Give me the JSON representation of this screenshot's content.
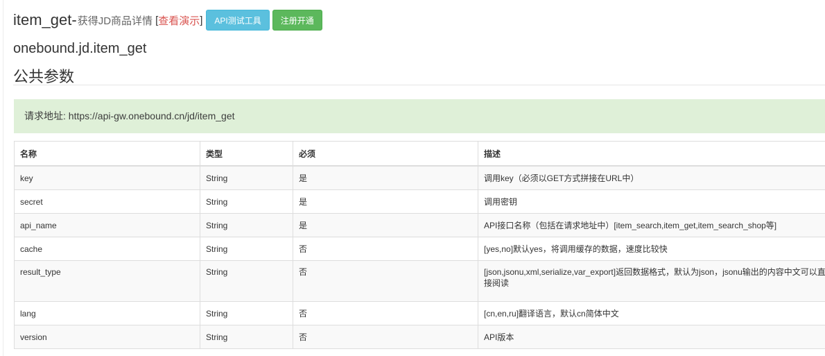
{
  "header": {
    "api_name": "item_get",
    "dash": "-",
    "subtitle": "获得JD商品详情",
    "bracket_open": "[",
    "demo_link": "查看演示",
    "bracket_close": "]",
    "api_test_button": "API测试工具",
    "register_button": "注册开通"
  },
  "method_name": "onebound.jd.item_get",
  "section_title": "公共参数",
  "request_url": "请求地址: https://api-gw.onebound.cn/jd/item_get",
  "table": {
    "headers": [
      "名称",
      "类型",
      "必须",
      "描述"
    ],
    "rows": [
      [
        "key",
        "String",
        "是",
        "调用key（必须以GET方式拼接在URL中）"
      ],
      [
        "secret",
        "String",
        "是",
        "调用密钥"
      ],
      [
        "api_name",
        "String",
        "是",
        "API接口名称（包括在请求地址中）[item_search,item_get,item_search_shop等]"
      ],
      [
        "cache",
        "String",
        "否",
        "[yes,no]默认yes，将调用缓存的数据，速度比较快"
      ],
      [
        "result_type",
        "String",
        "否",
        "[json,jsonu,xml,serialize,var_export]返回数据格式，默认为json，jsonu输出的内容中文可以直接阅读"
      ],
      [
        "lang",
        "String",
        "否",
        "[cn,en,ru]翻译语言，默认cn简体中文"
      ],
      [
        "version",
        "String",
        "否",
        "API版本"
      ]
    ]
  }
}
